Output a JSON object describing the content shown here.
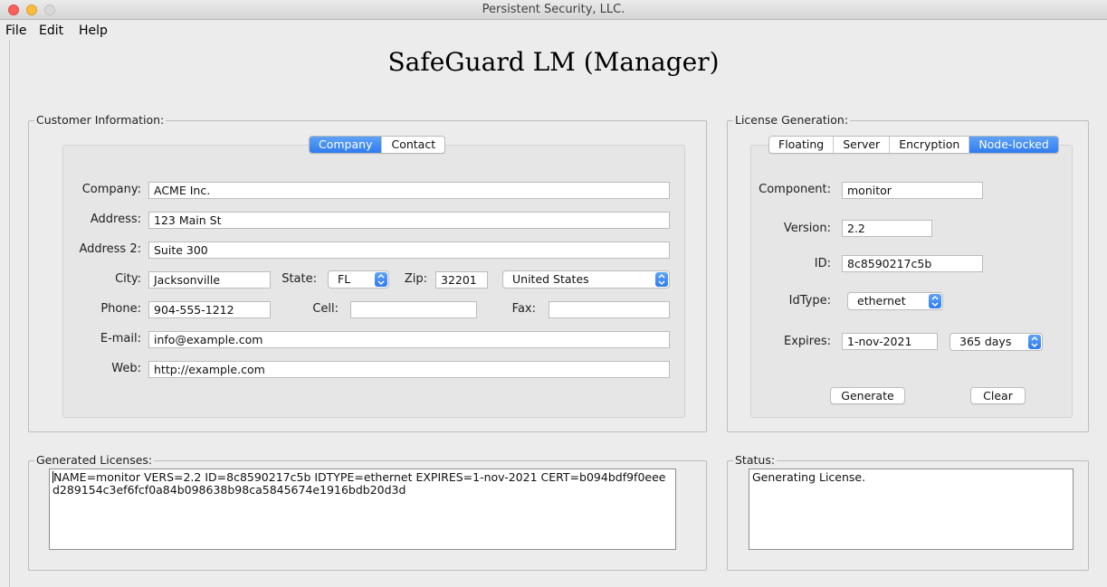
{
  "window": {
    "title": "Persistent Security, LLC."
  },
  "menu": {
    "file": "File",
    "edit": "Edit",
    "help": "Help"
  },
  "app_title": "SafeGuard LM (Manager)",
  "customer": {
    "group_label": "Customer Information:",
    "tabs": {
      "company": "Company",
      "contact": "Contact"
    },
    "labels": {
      "company": "Company:",
      "address": "Address:",
      "address2": "Address 2:",
      "city": "City:",
      "state": "State:",
      "zip": "Zip:",
      "phone": "Phone:",
      "cell": "Cell:",
      "fax": "Fax:",
      "email": "E-mail:",
      "web": "Web:"
    },
    "values": {
      "company": "ACME Inc.",
      "address": "123 Main St",
      "address2": "Suite 300",
      "city": "Jacksonville",
      "state": "FL",
      "zip": "32201",
      "country": "United States",
      "phone": "904-555-1212",
      "cell": "",
      "fax": "",
      "email": "info@example.com",
      "web": "http://example.com"
    }
  },
  "license": {
    "group_label": "License Generation:",
    "tabs": {
      "floating": "Floating",
      "server": "Server",
      "encryption": "Encryption",
      "nodelocked": "Node-locked"
    },
    "labels": {
      "component": "Component:",
      "version": "Version:",
      "id": "ID:",
      "idtype": "IdType:",
      "expires": "Expires:"
    },
    "values": {
      "component": "monitor",
      "version": "2.2",
      "id": "8c8590217c5b",
      "idtype": "ethernet",
      "expires": "1-nov-2021",
      "duration": "365 days"
    },
    "buttons": {
      "generate": "Generate",
      "clear": "Clear"
    }
  },
  "generated": {
    "group_label": "Generated Licenses:",
    "text": "NAME=monitor VERS=2.2 ID=8c8590217c5b IDTYPE=ethernet EXPIRES=1-nov-2021 CERT=b094bdf9f0eeed289154c3ef6fcf0a84b098638b98ca5845674e1916bdb20d3d"
  },
  "status": {
    "group_label": "Status:",
    "text": "Generating License."
  },
  "colors": {
    "accent": "#2f7cf0",
    "close": "#fc605c",
    "minimize": "#fdbc40"
  }
}
